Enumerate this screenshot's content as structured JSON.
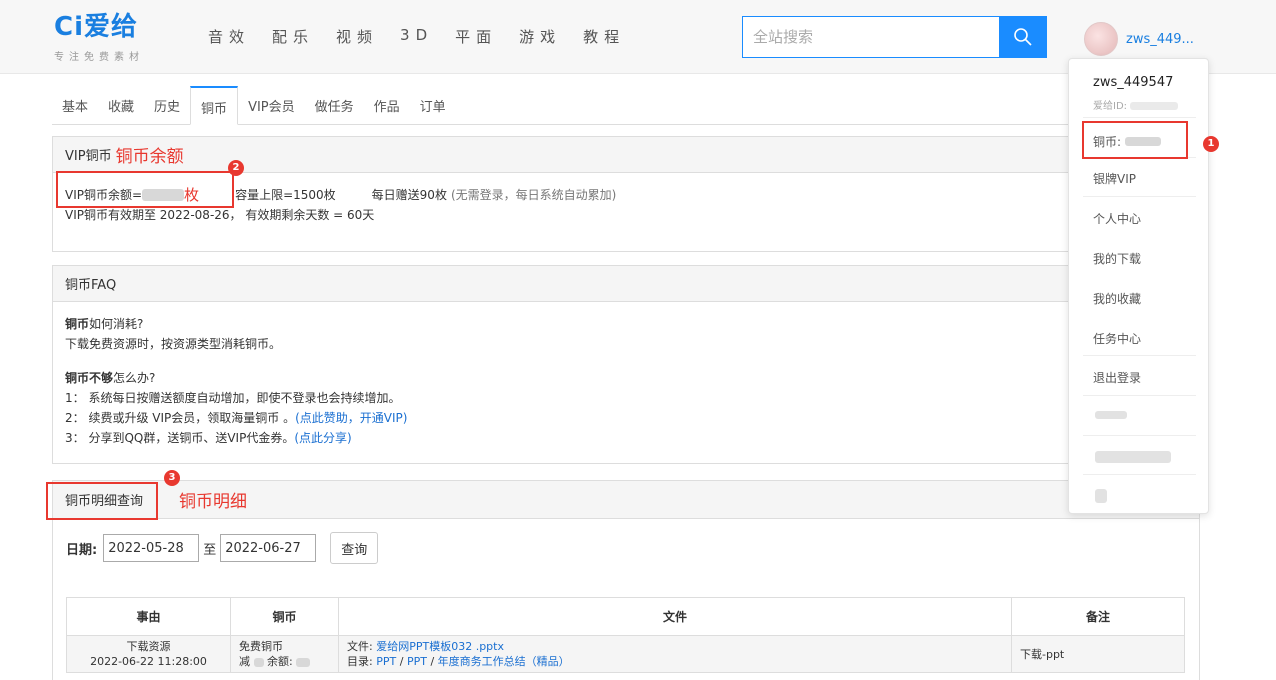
{
  "brand": {
    "logo_text": "Ci爱给",
    "tagline": "专注免费素材"
  },
  "nav": [
    "音效",
    "配乐",
    "视频",
    "3D",
    "平面",
    "游戏",
    "教程"
  ],
  "search": {
    "placeholder": "全站搜索",
    "icon": "search-icon"
  },
  "user": {
    "short_name": "zws_449...",
    "full_name": "zws_449547",
    "id_label": "爱给ID:"
  },
  "tabs": [
    "基本",
    "收藏",
    "历史",
    "铜币",
    "VIP会员",
    "做任务",
    "作品",
    "订单"
  ],
  "active_tab": "铜币",
  "coin_panel": {
    "title": "VIP铜币",
    "annotation": "铜币余额",
    "balance_label": "VIP铜币余额=",
    "unit": "枚",
    "capacity": "容量上限=1500枚",
    "daily": "每日赠送90枚",
    "daily_note": "(无需登录，每日系统自动累加)",
    "validity": "VIP铜币有效期至 2022-08-26， 有效期剩余天数 = 60天"
  },
  "faq": {
    "title": "铜币FAQ",
    "q1_bold": "铜币",
    "q1_rest": "如何消耗?",
    "a1": "下载免费资源时，按资源类型消耗铜币。",
    "q2_bold": "铜币不够",
    "q2_rest": "怎么办?",
    "item1": "1： 系统每日按赠送额度自动增加，即使不登录也会持续增加。",
    "item2": "2： 续费或升级 VIP会员，领取海量铜币 。",
    "item2_link": "(点此赞助，开通VIP)",
    "item3": "3： 分享到QQ群，送铜币、送VIP代金券。",
    "item3_link": "(点此分享)"
  },
  "detail": {
    "title": "铜币明细查询",
    "annotation": "铜币明细",
    "date_label": "日期:",
    "date_from": "2022-05-28",
    "to_label": "至",
    "date_to": "2022-06-27",
    "query_button": "查询"
  },
  "table": {
    "headers": [
      "事由",
      "铜币",
      "文件",
      "备注"
    ],
    "row": {
      "reason": "下载资源",
      "time": "2022-06-22 11:28:00",
      "coin_type": "免费铜币",
      "coin_reduce": "减",
      "coin_balance": "余额:",
      "file_label": "文件:",
      "file_name": "爱给网PPT模板032 .pptx",
      "dir_label": "目录:",
      "dir_1": "PPT",
      "dir_2": "PPT",
      "dir_3": "年度商务工作总结（精品）",
      "sep": "/",
      "note": "下载-ppt"
    }
  },
  "dropdown": {
    "coin_label": "铜币:",
    "items": [
      "银牌VIP",
      "个人中心",
      "我的下载",
      "我的收藏",
      "任务中心",
      "退出登录"
    ]
  },
  "badges": [
    "1",
    "2",
    "3"
  ],
  "colors": {
    "accent": "#1a8cff",
    "annotation_red": "#e8382f",
    "link": "#1a6fd1"
  }
}
